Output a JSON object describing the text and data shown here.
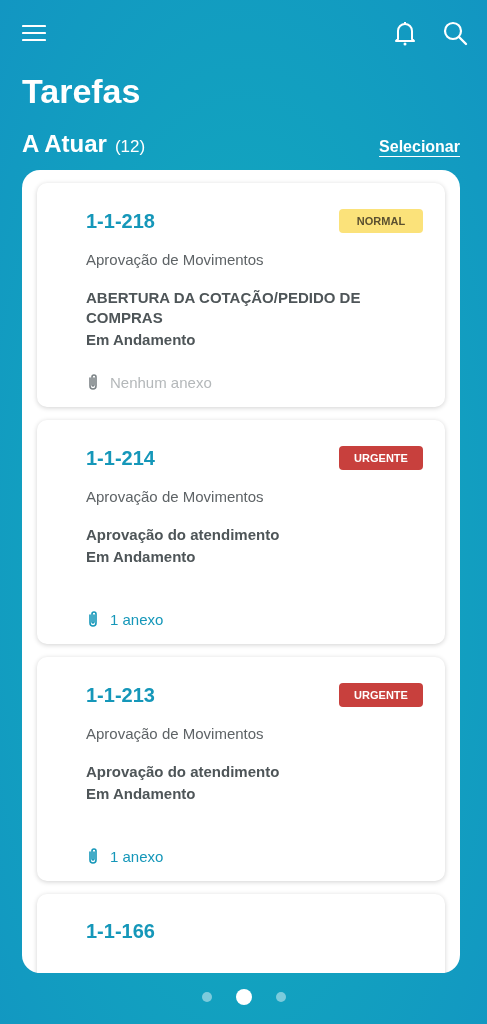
{
  "header": {
    "title": "Tarefas"
  },
  "section": {
    "title": "A Atuar",
    "count": "(12)",
    "action": "Selecionar"
  },
  "tasks": [
    {
      "id": "1-1-218",
      "priority": {
        "label": "NORMAL",
        "kind": "normal"
      },
      "process": "Aprovação de Movimentos",
      "title": "ABERTURA DA COTAÇÃO/PEDIDO DE COMPRAS",
      "status": "Em Andamento",
      "attachments": {
        "text": "Nenhum anexo",
        "has": false
      }
    },
    {
      "id": "1-1-214",
      "priority": {
        "label": "URGENTE",
        "kind": "urgent"
      },
      "process": "Aprovação de Movimentos",
      "title": "Aprovação do atendimento",
      "status": "Em Andamento",
      "attachments": {
        "text": "1 anexo",
        "has": true
      }
    },
    {
      "id": "1-1-213",
      "priority": {
        "label": "URGENTE",
        "kind": "urgent"
      },
      "process": "Aprovação de Movimentos",
      "title": "Aprovação do atendimento",
      "status": "Em Andamento",
      "attachments": {
        "text": "1 anexo",
        "has": true
      }
    },
    {
      "id": "1-1-166"
    }
  ],
  "pager": [
    {
      "selected": false
    },
    {
      "selected": true
    },
    {
      "selected": false
    }
  ]
}
